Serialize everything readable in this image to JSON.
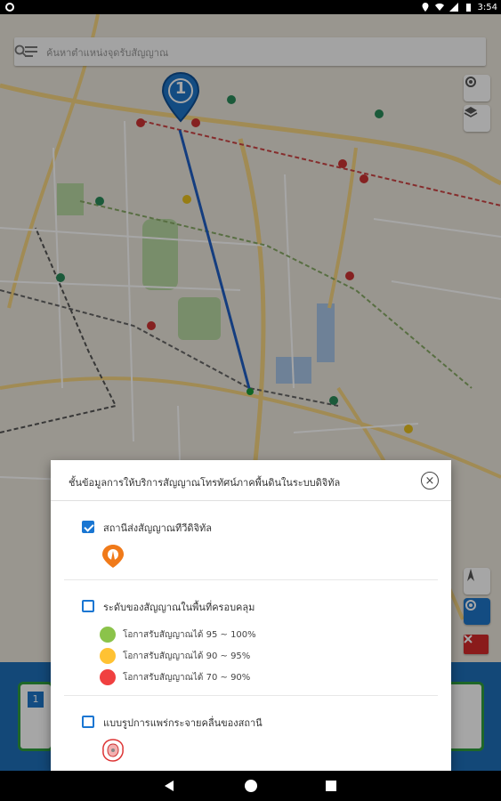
{
  "status_bar": {
    "time": "3:54"
  },
  "search": {
    "placeholder": "ค้นหาตำแหน่งจุดรับสัญญาณ"
  },
  "marker": {
    "label": "1"
  },
  "dialog": {
    "title": "ชั้นข้อมูลการให้บริการสัญญาณโทรทัศน์ภาคพื้นดินในระบบดิจิทัล",
    "close_icon": "close-circle-icon",
    "sections": [
      {
        "label": "สถานีส่งสัญญาณทีวีดิจิทัล",
        "checked": true,
        "icon": "tower-pin-icon"
      },
      {
        "label": "ระดับของสัญญาณในพื้นที่ครอบคลุม",
        "checked": false,
        "legend": [
          {
            "label": "โอกาสรับสัญญาณได้ 95 ~ 100%",
            "color": "#8bc34a"
          },
          {
            "label": "โอกาสรับสัญญาณได้ 90 ~ 95%",
            "color": "#ffc233"
          },
          {
            "label": "โอกาสรับสัญญาณได้ 70 ~ 90%",
            "color": "#f04040"
          }
        ]
      },
      {
        "label": "แบบรูปการแพร่กระจายคลื่นของสถานี",
        "checked": false,
        "icon": "radiation-pattern-icon"
      }
    ]
  },
  "bottom_panel": {
    "card_number": "1"
  },
  "colors": {
    "accent": "#1976d2",
    "panel": "#1e6fb8"
  }
}
